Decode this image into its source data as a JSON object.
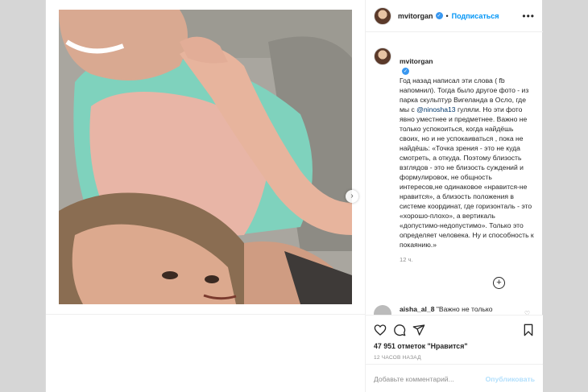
{
  "post": {
    "author": "mvitorgan",
    "verified": true,
    "follow_label": "Подписаться",
    "dot": "•",
    "more_icon": "more-horizontal-icon",
    "caption_author": "mvitorgan",
    "caption_before_mention": "Год назад написал эти слова ( fb напомнил). Тогда было другое фото - из парка скульптур Вигеланда в Осло, где мы с ",
    "caption_mention": "@ninosha13",
    "caption_after_mention": " гуляли. Но эти фото явно уместнее и предметнее. Важно не только успокоиться, когда найдёшь своих, но и не успокаиваться , пока не найдёшь: «Точка зрения - это не куда смотреть, а откуда. Поэтому близость взглядов - это не близость суждений и формулировок, не общность интересов,не одинаковое «нравится-не нравится», а близость положения в системе координат, где горизонталь - это «хорошо-плохо», а вертикаль «допустимо-недопустимо». Только это определяет человека. Ну и способность к покаянию.»",
    "caption_time": "12 ч.",
    "load_more_symbol": "+",
    "next_comment_user": "aisha_al_8",
    "next_comment_text": "\"Важно не только",
    "likes": "47 951 отметок \"Нравится\"",
    "post_time": "12 ЧАСОВ НАЗАД",
    "comment_placeholder": "Добавьте комментарий...",
    "publish_label": "Опубликовать",
    "carousel_next_symbol": "›"
  },
  "icons": [
    "heart-icon",
    "comment-icon",
    "share-icon",
    "bookmark-icon",
    "plus-circle-icon",
    "chevron-right-icon",
    "verified-icon"
  ],
  "colors": {
    "accent": "#0095f6",
    "mention": "#00376b",
    "publish_disabled": "#b2dffc",
    "muted": "#8e8e8e"
  }
}
